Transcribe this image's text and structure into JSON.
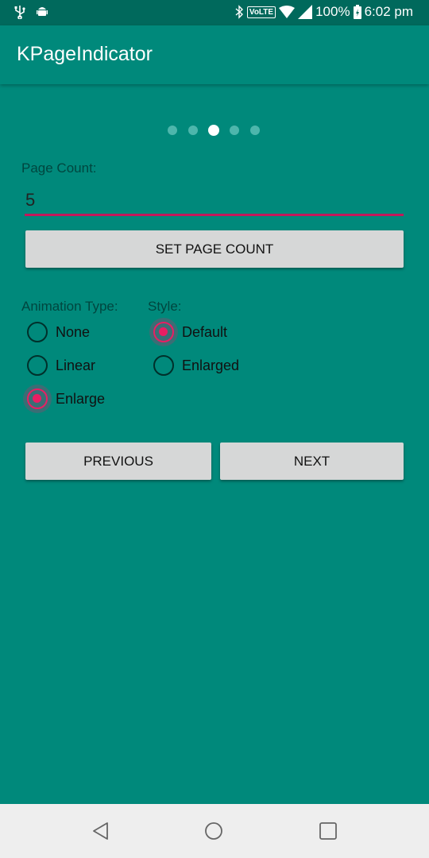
{
  "status_bar": {
    "icons": [
      "usb-icon",
      "android-debug-icon",
      "bluetooth-icon",
      "wifi-icon",
      "signal-icon",
      "battery-icon"
    ],
    "volte": "VoLTE",
    "battery": "100%",
    "time": "6:02 pm"
  },
  "app_bar": {
    "title": "KPageIndicator"
  },
  "indicator": {
    "page_count": 5,
    "current_page_index": 2
  },
  "page_count": {
    "label": "Page Count:",
    "value": "5",
    "button": "SET PAGE COUNT"
  },
  "animation": {
    "label": "Animation Type:",
    "options": [
      "None",
      "Linear",
      "Enlarge"
    ],
    "selected": "Enlarge"
  },
  "style": {
    "label": "Style:",
    "options": [
      "Default",
      "Enlarged"
    ],
    "selected": "Default"
  },
  "nav_buttons": {
    "previous": "PREVIOUS",
    "next": "NEXT"
  },
  "colors": {
    "primary": "#00897B",
    "primary_dark": "#00695C",
    "accent": "#E91E63"
  }
}
